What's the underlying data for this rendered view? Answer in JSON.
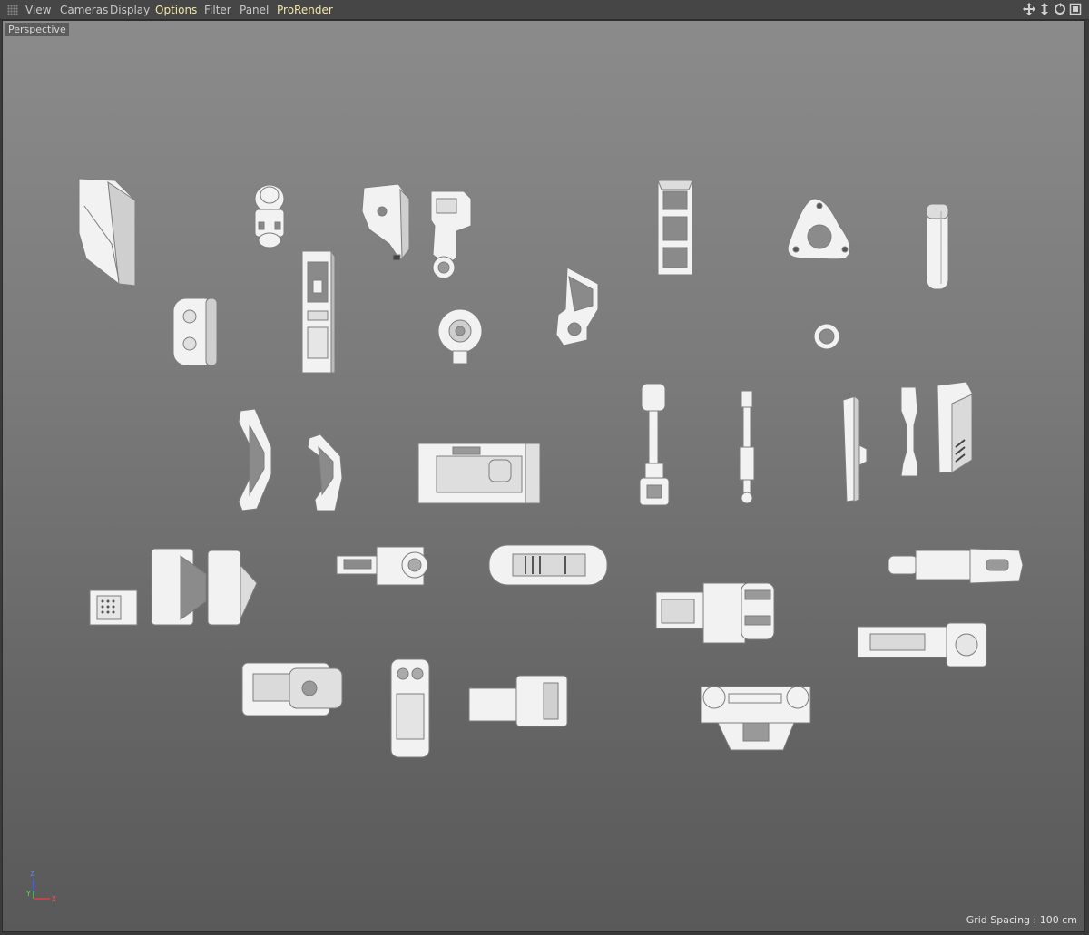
{
  "menubar": {
    "items": [
      "View",
      "Cameras",
      "Display",
      "Options",
      "Filter",
      "Panel",
      "ProRender"
    ],
    "highlight_color": "#f2e6a6"
  },
  "nav_icons": [
    "move-view-icon",
    "dolly-view-icon",
    "rotate-view-icon",
    "toggle-view-icon"
  ],
  "viewport": {
    "camera_label": "Perspective",
    "grid_spacing": "Grid Spacing : 100 cm",
    "axis": {
      "z": "Z",
      "y": "Y",
      "x": "X"
    }
  },
  "colors": {
    "model": "#f2f2f2",
    "edge": "#7d7d7d",
    "axis_x": "#e04040",
    "axis_y": "#40d040",
    "axis_z": "#4060ff"
  }
}
